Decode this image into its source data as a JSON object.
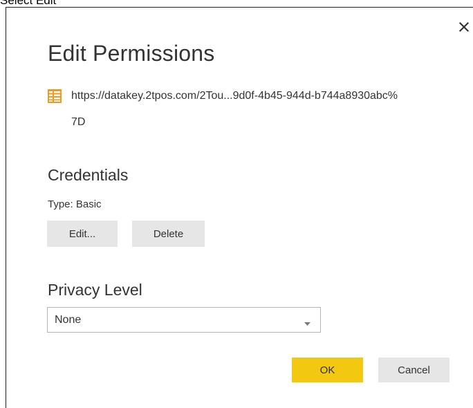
{
  "caption": "Select Edit",
  "dialog": {
    "title": "Edit Permissions",
    "close_icon": "close-icon",
    "source": {
      "icon": "table-icon",
      "url": "https://datakey.2tpos.com/2Tou...9d0f-4b45-944d-b744a8930abc%7D"
    },
    "credentials": {
      "heading": "Credentials",
      "type_label": "Type: Basic",
      "edit_button": "Edit...",
      "delete_button": "Delete"
    },
    "privacy": {
      "heading": "Privacy Level",
      "selected": "None",
      "dropdown_icon": "chevron-down-icon"
    },
    "footer": {
      "ok_button": "OK",
      "cancel_button": "Cancel"
    }
  },
  "colors": {
    "accent_button": "#f2c811",
    "secondary_button": "#e6e6e6",
    "icon_orange": "#f29a1d",
    "text": "#333333"
  }
}
